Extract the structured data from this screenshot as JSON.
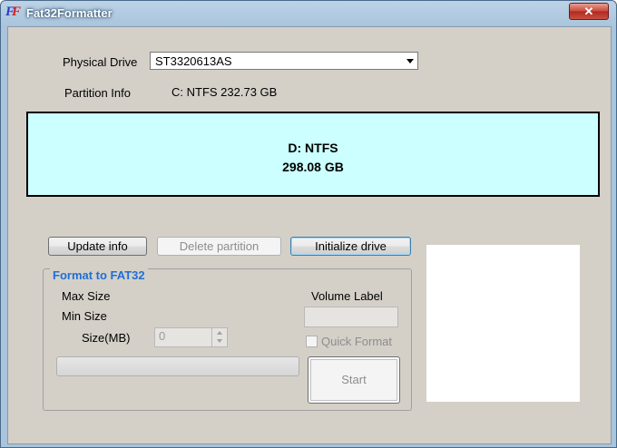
{
  "window": {
    "title": "Fat32Formatter",
    "icon_name": "app-logo-icon",
    "close_glyph": "✕"
  },
  "drive": {
    "label": "Physical Drive",
    "selected": "ST3320613AS"
  },
  "partition_info": {
    "label": "Partition Info",
    "value": "C: NTFS  232.73 GB"
  },
  "selected_partition": {
    "name": "D: NTFS",
    "size": "298.08 GB",
    "color": "#ccffff"
  },
  "buttons": {
    "update": "Update info",
    "delete": "Delete partition",
    "initialize": "Initialize drive"
  },
  "format": {
    "group_title": "Format to FAT32",
    "max_size_label": "Max Size",
    "min_size_label": "Min Size",
    "size_label": "Size(MB)",
    "size_value": "0",
    "volume_label_title": "Volume Label",
    "volume_label_value": "",
    "quick_format_label": "Quick Format",
    "quick_format_checked": false,
    "progress": 0,
    "start_label": "Start"
  }
}
